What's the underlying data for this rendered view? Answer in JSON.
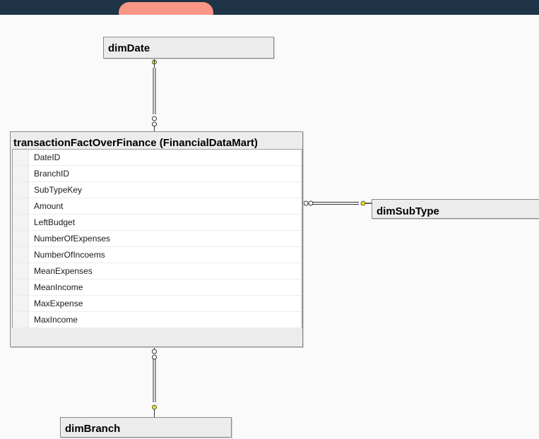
{
  "diagram": {
    "tables": {
      "dim_date": {
        "title": "dimDate"
      },
      "fact": {
        "title": "transactionFactOverFinance (FinancialDataMart)",
        "columns": [
          "DateID",
          "BranchID",
          "SubTypeKey",
          "Amount",
          "LeftBudget",
          "NumberOfExpenses",
          "NumberOfIncoems",
          "MeanExpenses",
          "MeanIncome",
          "MaxExpense",
          "MaxIncome"
        ]
      },
      "dim_subtype": {
        "title": "dimSubType"
      },
      "dim_branch": {
        "title": "dimBranch"
      }
    },
    "colors": {
      "key_icon": "#f0e020",
      "header_bar": "#1e3346",
      "accent_pill": "#f99685"
    }
  }
}
